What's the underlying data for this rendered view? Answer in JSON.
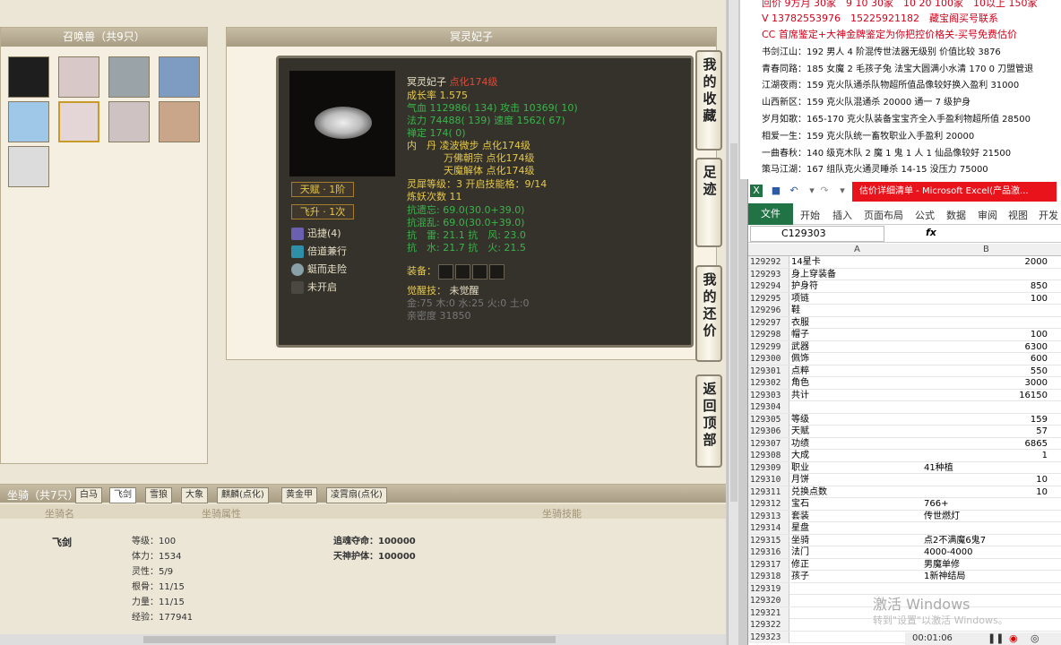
{
  "pets_panel": {
    "title": "召唤兽（共9只）",
    "pets": [
      {
        "name": "pet-1",
        "color": "#1e1e1e"
      },
      {
        "name": "pet-2",
        "color": "#d8c8c8"
      },
      {
        "name": "pet-3",
        "color": "#9aa3a8"
      },
      {
        "name": "pet-4",
        "color": "#7e9bc2"
      },
      {
        "name": "pet-5",
        "color": "#9ec7e8"
      },
      {
        "name": "pet-6",
        "color": "#e4d6d6"
      },
      {
        "name": "pet-7",
        "color": "#cfc2c2"
      },
      {
        "name": "pet-8",
        "color": "#c9a58a"
      },
      {
        "name": "pet-9",
        "color": "#dcdcdc"
      }
    ]
  },
  "detail": {
    "title": "冥灵妃子",
    "name": "冥灵妃子",
    "enhance": "点化174级",
    "growth": "成长率 1.575",
    "hp_label": "气血",
    "hp": "112986( 134)",
    "atk_label": "攻击",
    "atk": "10369( 10)",
    "mp_label": "法力",
    "mp": "74488( 139)",
    "spd_label": "速度",
    "spd": "1562( 67)",
    "zen_label": "禅定",
    "zen": "174( 0)",
    "neidan_label": "内　丹",
    "neidan_1": "凌波微步 点化174级",
    "neidan_2": "万佛朝宗 点化174级",
    "neidan_3": "天魔解体 点化174级",
    "spirit_label": "灵犀等级：",
    "spirit": "3 开启技能格：9/14",
    "refine": "炼妖次数 11",
    "resist_1": "抗遗忘: 69.0(30.0+39.0)",
    "resist_2": "抗混乱: 69.0(30.0+39.0)",
    "resist_3": "抗　雷: 21.1 抗　风: 23.0",
    "resist_4": "抗　水: 21.7 抗　火: 21.5",
    "equip_label": "装备：",
    "awaken_label": "觉醒技：",
    "awaken": "未觉醒",
    "elements": "金:75 木:0 水:25 火:0 土:0",
    "intimacy": "亲密度 31850",
    "talent": "天赋 · 1阶",
    "feisheng": "飞升 · 1次",
    "skills": [
      "迅捷(4)",
      "倍道兼行",
      "蜓而走险",
      "未开启"
    ]
  },
  "side_buttons": [
    "我的收藏",
    "足迹",
    "我的还价",
    "返回顶部"
  ],
  "mount": {
    "title": "坐骑（共7只）",
    "tabs": [
      "白马",
      "飞剑",
      "雪狼",
      "大象",
      "麒麟(点化)",
      "黄金甲",
      "凌霄扇(点化)"
    ],
    "col_name": "坐骑名",
    "col_attr": "坐骑属性",
    "col_skill": "坐骑技能",
    "name": "飞剑",
    "attrs": [
      "等级：100",
      "体力：1534",
      "灵性：5/9",
      "根骨：11/15",
      "力量：11/15",
      "经验：177941"
    ],
    "skills": [
      "追魂夺命：100000",
      "天神护体：100000"
    ]
  },
  "notes": {
    "line0": "回价 9方月 30家　9 10 30家　10 20 100家　10以上 150家",
    "line1": "V 13782553976　15225921182　藏宝阁买号联系",
    "line2": "CC 首席鉴定+大神金牌鉴定为你把控价格关-买号免费估价",
    "rows": [
      "书剑江山：192 男人 4 阶混传世法器无级别 价值比较 3876",
      "青春同路：185 女魔 2 毛孩子兔 法宝大圆满小水清 170 0 刀盟管退",
      "江湖夜雨：159 克火队通杀队物超所值品像较好换入盈利 31000",
      "山西新区：159 克火队混通杀 20000 通一 7 级护身",
      "岁月如歌：165-170 克火队装备宝宝齐全入手盈利物超所值 28500",
      "相爱一生：159 克火队统一畜牧职业入手盈利 20000",
      "一曲春秋：140 级克木队 2 魔 1 鬼 1 人 1 仙品像较好 21500",
      "策马江湖：167 组队克火通灵睡杀 14-15 没压力 75000"
    ]
  },
  "excel": {
    "title": "估价详细清单 - Microsoft Excel(产品激...",
    "ribbon_tabs": [
      "文件",
      "开始",
      "插入",
      "页面布局",
      "公式",
      "数据",
      "审阅",
      "视图",
      "开发工"
    ],
    "name_box": "C129303",
    "fx": "fx",
    "col_a": "A",
    "col_b": "B",
    "rows": [
      {
        "n": "129292",
        "a": "14星卡",
        "b": "2000",
        "num": true
      },
      {
        "n": "129293",
        "a": "身上穿装备",
        "b": ""
      },
      {
        "n": "129294",
        "a": "护身符",
        "b": "850",
        "num": true
      },
      {
        "n": "129295",
        "a": "项链",
        "b": "100",
        "num": true
      },
      {
        "n": "129296",
        "a": "鞋",
        "b": ""
      },
      {
        "n": "129297",
        "a": "衣服",
        "b": ""
      },
      {
        "n": "129298",
        "a": "帽子",
        "b": "100",
        "num": true
      },
      {
        "n": "129299",
        "a": "武器",
        "b": "6300",
        "num": true
      },
      {
        "n": "129300",
        "a": "佩饰",
        "b": "600",
        "num": true
      },
      {
        "n": "129301",
        "a": "点粹",
        "b": "550",
        "num": true
      },
      {
        "n": "129302",
        "a": "角色",
        "b": "3000",
        "num": true
      },
      {
        "n": "129303",
        "a": "共计",
        "b": "16150",
        "num": true
      },
      {
        "n": "129304",
        "a": "",
        "b": ""
      },
      {
        "n": "129305",
        "a": "等级",
        "b": "159",
        "num": true
      },
      {
        "n": "129306",
        "a": "天赋",
        "b": "57",
        "num": true
      },
      {
        "n": "129307",
        "a": "功绩",
        "b": "6865",
        "num": true
      },
      {
        "n": "129308",
        "a": "大成",
        "b": "1",
        "num": true
      },
      {
        "n": "129309",
        "a": "职业",
        "b": "41种植"
      },
      {
        "n": "129310",
        "a": "月饼",
        "b": "10",
        "num": true
      },
      {
        "n": "129311",
        "a": "兑换点数",
        "b": "10",
        "num": true
      },
      {
        "n": "129312",
        "a": "宝石",
        "b": "766+"
      },
      {
        "n": "129313",
        "a": "套装",
        "b": "传世燃灯"
      },
      {
        "n": "129314",
        "a": "星盘",
        "b": ""
      },
      {
        "n": "129315",
        "a": "坐骑",
        "b": "点2不满魔6鬼7"
      },
      {
        "n": "129316",
        "a": "法门",
        "b": "4000-4000"
      },
      {
        "n": "129317",
        "a": "修正",
        "b": "男魔单修"
      },
      {
        "n": "129318",
        "a": "孩子",
        "b": "1新神结局"
      },
      {
        "n": "129319",
        "a": "",
        "b": ""
      },
      {
        "n": "129320",
        "a": "",
        "b": ""
      },
      {
        "n": "129321",
        "a": "",
        "b": ""
      },
      {
        "n": "129322",
        "a": "",
        "b": ""
      },
      {
        "n": "129323",
        "a": "",
        "b": ""
      }
    ]
  },
  "watermark": {
    "line1": "激活 Windows",
    "line2": "转到\"设置\"以激活 Windows。"
  },
  "player": {
    "time": "00:01:06"
  }
}
